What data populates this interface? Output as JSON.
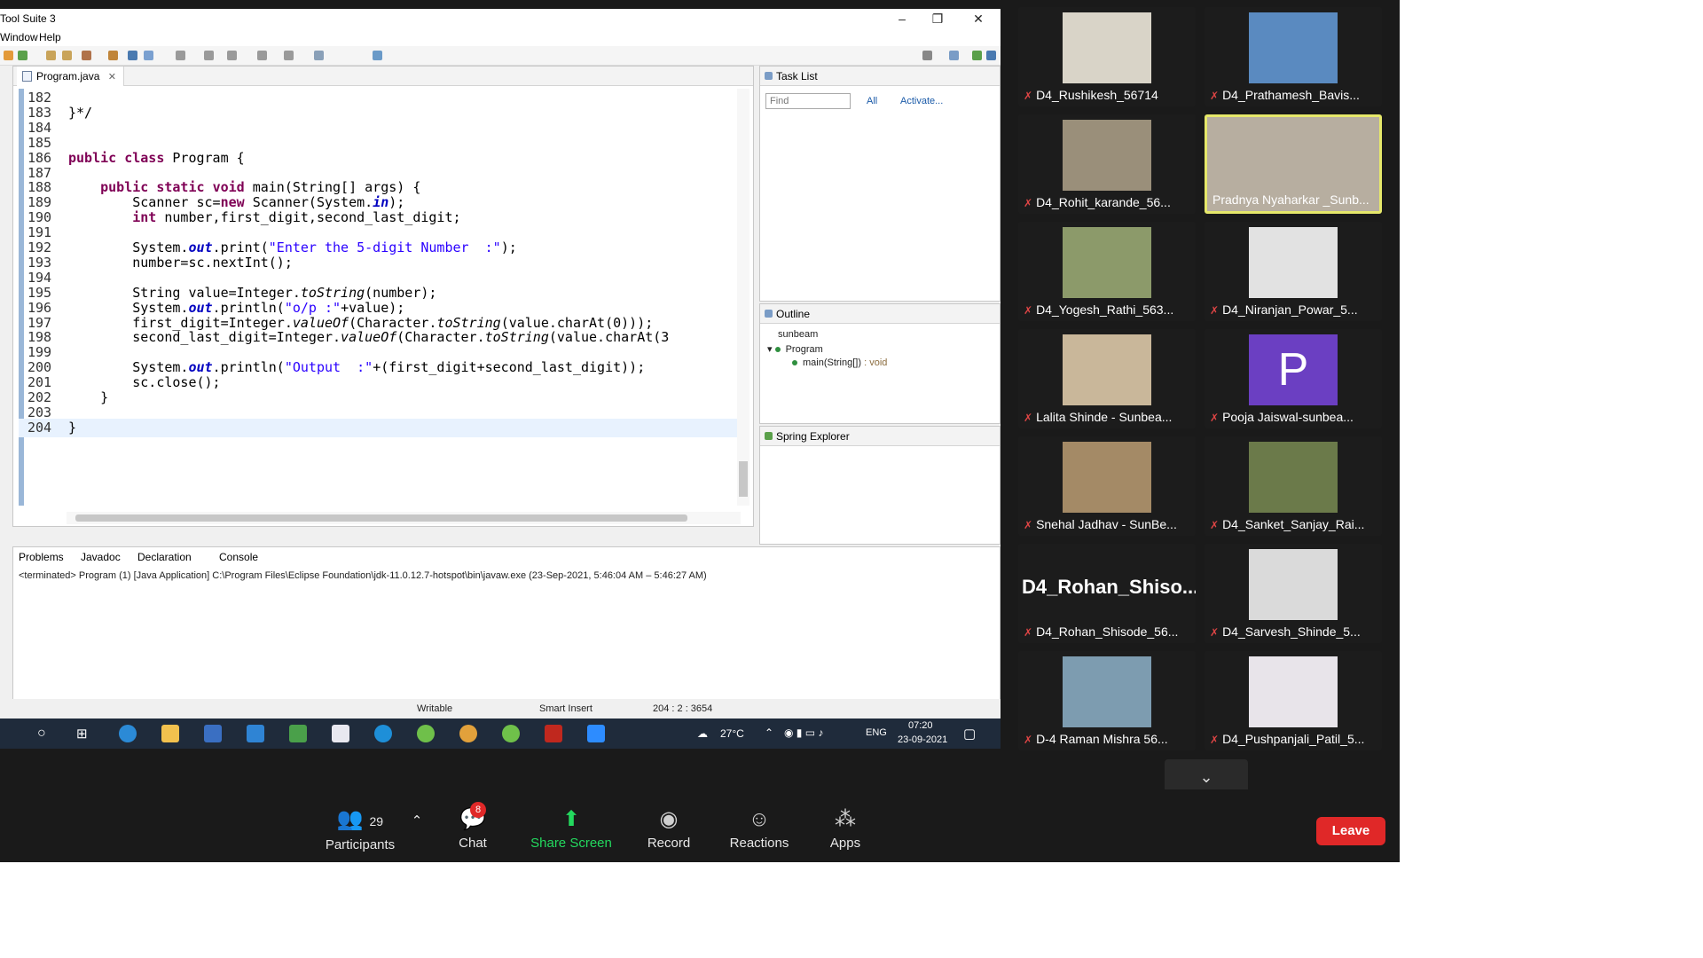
{
  "eclipse": {
    "window_title": "Tool Suite 3",
    "menu": [
      "Window",
      "Help"
    ],
    "editor_tab": "Program.java",
    "code_lines": [
      {
        "n": "182",
        "t": ""
      },
      {
        "n": "183",
        "t": "}*/"
      },
      {
        "n": "184",
        "t": ""
      },
      {
        "n": "185",
        "t": ""
      },
      {
        "n": "186",
        "t": "public class Program {"
      },
      {
        "n": "187",
        "t": ""
      },
      {
        "n": "188",
        "t": "    public static void main(String[] args) {"
      },
      {
        "n": "189",
        "t": "        Scanner sc=new Scanner(System.in);"
      },
      {
        "n": "190",
        "t": "        int number,first_digit,second_last_digit;"
      },
      {
        "n": "191",
        "t": ""
      },
      {
        "n": "192",
        "t": "        System.out.print(\"Enter the 5-digit Number  :\");"
      },
      {
        "n": "193",
        "t": "        number=sc.nextInt();"
      },
      {
        "n": "194",
        "t": ""
      },
      {
        "n": "195",
        "t": "        String value=Integer.toString(number);"
      },
      {
        "n": "196",
        "t": "        System.out.println(\"o/p :\"+value);"
      },
      {
        "n": "197",
        "t": "        first_digit=Integer.valueOf(Character.toString(value.charAt(0)));"
      },
      {
        "n": "198",
        "t": "        second_last_digit=Integer.valueOf(Character.toString(value.charAt(3"
      },
      {
        "n": "199",
        "t": ""
      },
      {
        "n": "200",
        "t": "        System.out.println(\"Output  :\"+(first_digit+second_last_digit));"
      },
      {
        "n": "201",
        "t": "        sc.close();"
      },
      {
        "n": "202",
        "t": "    }"
      },
      {
        "n": "203",
        "t": ""
      },
      {
        "n": "204",
        "t": "}"
      }
    ],
    "task_list": {
      "title": "Task List",
      "find_placeholder": "Find",
      "all": "All",
      "activate": "Activate..."
    },
    "outline": {
      "title": "Outline",
      "items": [
        "sunbeam",
        "Program",
        "main(String[])",
        ": void"
      ]
    },
    "spring_explorer": "Spring Explorer",
    "console_tabs": [
      "Problems",
      "Javadoc",
      "Declaration",
      "Console"
    ],
    "terminated_text": "<terminated> Program (1) [Java Application] C:\\Program Files\\Eclipse Foundation\\jdk-11.0.12.7-hotspot\\bin\\javaw.exe  (23-Sep-2021, 5:46:04 AM – 5:46:27 AM)",
    "status": {
      "writable": "Writable",
      "insert": "Smart Insert",
      "position": "204 : 2 : 3654"
    }
  },
  "taskbar": {
    "weather": "27°C",
    "lang": "ENG",
    "time": "07:20",
    "date": "23-09-2021"
  },
  "participants": [
    {
      "name": "D4_Rushikesh_56714",
      "color": "#d9d4c8"
    },
    {
      "name": "D4_Prathamesh_Bavis...",
      "color": "#5a8ac0"
    },
    {
      "name": "D4_Rohit_karande_56...",
      "color": "#9a8f7a"
    },
    {
      "name": "Pradnya Nyaharkar _Sunb...",
      "color": "#b7aea0"
    },
    {
      "name": "D4_Yogesh_Rathi_563...",
      "color": "#8c9a6a"
    },
    {
      "name": "D4_Niranjan_Powar_5...",
      "color": "#e2e2e2"
    },
    {
      "name": "Lalita Shinde - Sunbea...",
      "color": "#c9b79a"
    },
    {
      "name": "Pooja Jaiswal-sunbea...",
      "color": "#6b3fc2"
    },
    {
      "name": "Snehal Jadhav - SunBe...",
      "color": "#a48a66"
    },
    {
      "name": "D4_Sanket_Sanjay_Rai...",
      "color": "#6b7a4a"
    },
    {
      "name": "D4_Rohan_Shisode_56...",
      "color": "#1c1c1c"
    },
    {
      "name": "D4_Sarvesh_Shinde_5...",
      "color": "#dadada"
    },
    {
      "name": "D-4 Raman Mishra 56...",
      "color": "#7d9cb0"
    },
    {
      "name": "D4_Pushpanjali_Patil_5...",
      "color": "#e8e4ea"
    }
  ],
  "big_name": "D4_Rohan_Shiso...",
  "pooja_initial": "P",
  "zoom": {
    "participants_count": "29",
    "participants_label": "Participants",
    "chat_label": "Chat",
    "chat_badge": "8",
    "share_label": "Share Screen",
    "record_label": "Record",
    "reactions_label": "Reactions",
    "apps_label": "Apps",
    "leave_label": "Leave"
  }
}
